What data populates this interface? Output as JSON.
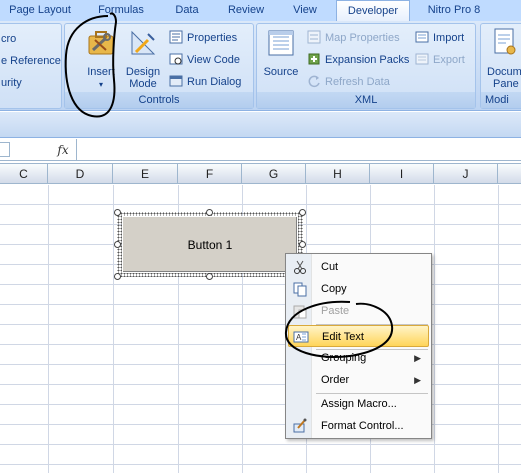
{
  "tabs": [
    {
      "label": "Page Layout",
      "active": false
    },
    {
      "label": "Formulas",
      "active": false
    },
    {
      "label": "Data",
      "active": false
    },
    {
      "label": "Review",
      "active": false
    },
    {
      "label": "View",
      "active": false
    },
    {
      "label": "Developer",
      "active": true
    },
    {
      "label": "Nitro Pro 8",
      "active": false
    }
  ],
  "ribbon": {
    "code_group": {
      "items": [
        "cro",
        "e Reference",
        "urity"
      ]
    },
    "controls_group": {
      "label": "Controls",
      "insert_label": "Insert",
      "design_mode_label_1": "Design",
      "design_mode_label_2": "Mode",
      "properties_label": "Properties",
      "view_code_label": "View Code",
      "run_dialog_label": "Run Dialog"
    },
    "xml_group": {
      "label": "XML",
      "source_label": "Source",
      "map_properties_label": "Map Properties",
      "expansion_packs_label": "Expansion Packs",
      "refresh_data_label": "Refresh Data",
      "import_label": "Import",
      "export_label": "Export"
    },
    "modify_group": {
      "label": "Modi",
      "document_panel_label_1": "Docum",
      "document_panel_label_2": "Pane"
    }
  },
  "formula_bar": {
    "fx": "fx"
  },
  "columns": [
    "C",
    "D",
    "E",
    "F",
    "G",
    "H",
    "I",
    "J"
  ],
  "form_button": {
    "label": "Button 1"
  },
  "context_menu": {
    "items": [
      {
        "label": "Cut",
        "icon": "scissors-icon"
      },
      {
        "label": "Copy",
        "icon": "copy-icon"
      },
      {
        "label": "Paste",
        "icon": "paste-icon",
        "disabled": true
      },
      {
        "label": "Edit Text",
        "icon": "edit-text-icon",
        "highlighted": true
      },
      {
        "label": "Grouping",
        "submenu": true
      },
      {
        "label": "Order",
        "submenu": true
      },
      {
        "label": "Assign Macro..."
      },
      {
        "label": "Format Control...",
        "icon": "format-control-icon"
      }
    ]
  },
  "colors": {
    "ribbon_text": "#15428b",
    "highlight": "#ffd55a",
    "annotation": "#000000"
  }
}
